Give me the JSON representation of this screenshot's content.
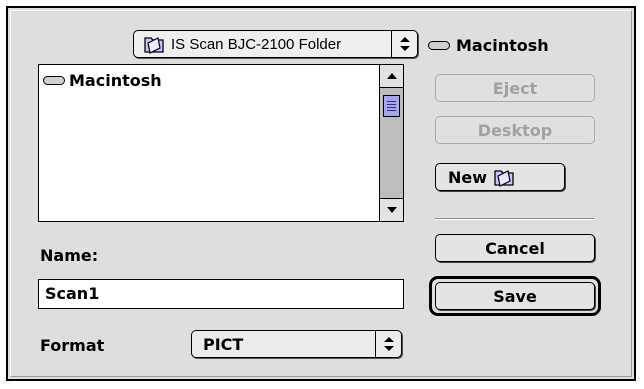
{
  "dialog": {
    "folder_popup": {
      "label": "IS Scan BJC-2100 Folder",
      "icon": "folder-icon"
    },
    "volume": {
      "label": "Macintosh",
      "icon": "disk-icon"
    },
    "file_list": {
      "items": [
        {
          "label": "Macintosh",
          "icon": "disk-icon"
        }
      ]
    },
    "buttons": {
      "eject": "Eject",
      "desktop": "Desktop",
      "new": "New",
      "cancel": "Cancel",
      "save": "Save"
    },
    "name_field": {
      "label": "Name:",
      "value": "Scan1"
    },
    "format": {
      "label": "Format",
      "value": "PICT"
    }
  }
}
